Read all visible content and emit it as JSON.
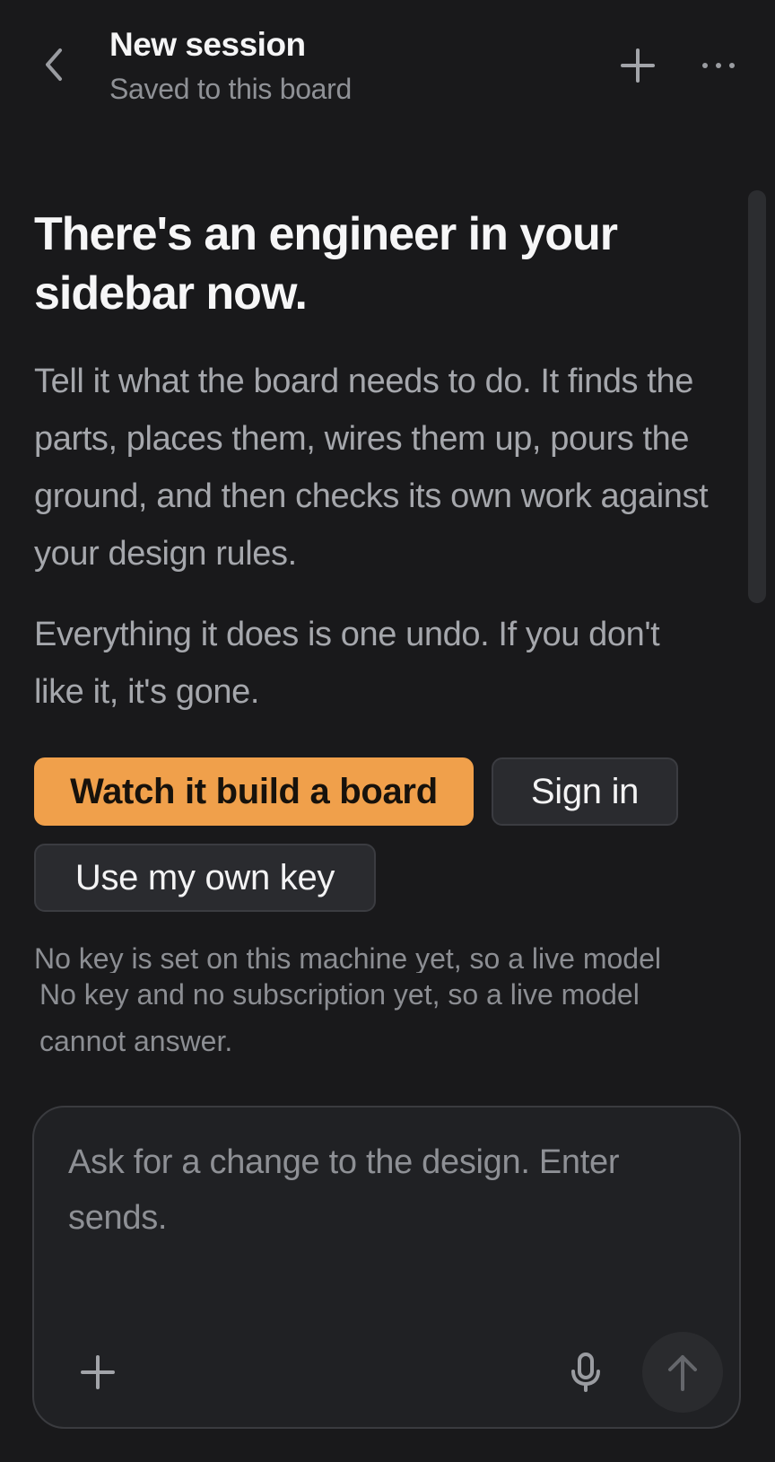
{
  "header": {
    "title": "New session",
    "subtitle": "Saved to this board",
    "back_icon": "chevron-left-icon",
    "new_icon": "plus-icon",
    "more_icon": "more-horizontal-icon"
  },
  "intro": {
    "headline": "There's an engineer in your sidebar now.",
    "paragraph1": "Tell it what the board needs to do. It finds the parts, places them, wires them up, pours the ground, and then checks its own work against your design rules.",
    "paragraph2": "Everything it does is one undo. If you don't like it, it's gone."
  },
  "actions": {
    "primary_label": "Watch it build a board",
    "signin_label": "Sign in",
    "own_key_label": "Use my own key"
  },
  "notices": {
    "clipped": "No key is set on this machine yet, so a live model",
    "status": "No key and no subscription yet, so a live model cannot answer."
  },
  "composer": {
    "placeholder": "Ask for a change to the design. Enter sends.",
    "attach_icon": "plus-icon",
    "mic_icon": "microphone-icon",
    "send_icon": "arrow-up-icon"
  },
  "colors": {
    "background": "#19191b",
    "accent": "#f0a04b",
    "muted_text": "#a5a7ac"
  }
}
